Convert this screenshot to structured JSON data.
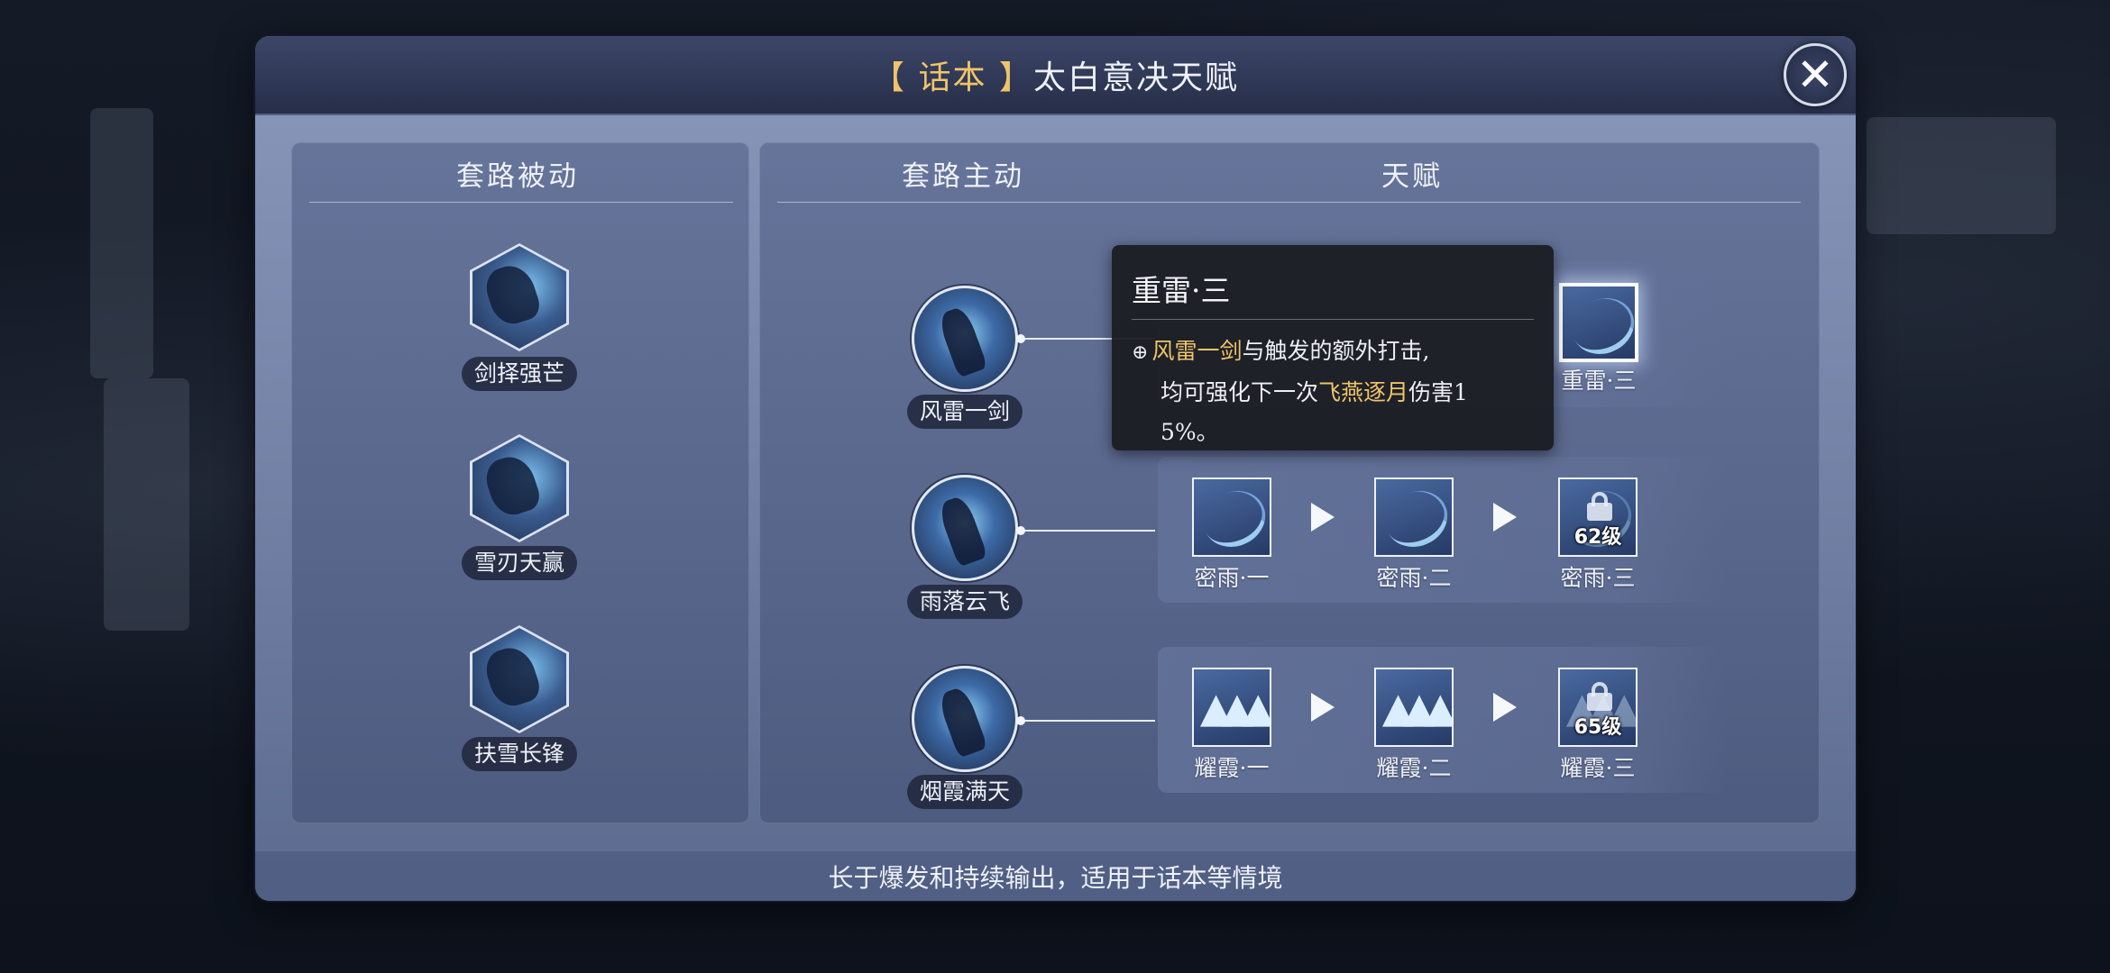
{
  "window": {
    "title_tag": "【 话本 】",
    "title": "太白意决天赋",
    "close_glyph": "✕"
  },
  "columns": {
    "passive": "套路被动",
    "active": "套路主动",
    "talent": "天赋"
  },
  "passive_skills": [
    {
      "name": "剑择强芒"
    },
    {
      "name": "雪刃天赢"
    },
    {
      "name": "扶雪长锋"
    }
  ],
  "active_skills": [
    {
      "name": "风雷一剑"
    },
    {
      "name": "雨落云飞"
    },
    {
      "name": "烟霞满天"
    }
  ],
  "talents": {
    "row1": [
      {
        "label": "重雷·三",
        "selected": true,
        "icon": "lightning-slash-icon"
      }
    ],
    "row2": [
      {
        "label": "密雨·一",
        "icon": "rain-slash-icon"
      },
      {
        "label": "密雨·二",
        "icon": "rain-slash-icon"
      },
      {
        "label": "密雨·三",
        "locked": true,
        "level_req": "62级",
        "icon": "lock-icon"
      }
    ],
    "row3": [
      {
        "label": "耀霞·一",
        "icon": "arrows-up-icon"
      },
      {
        "label": "耀霞·二",
        "icon": "arrows-up-icon"
      },
      {
        "label": "耀霞·三",
        "locked": true,
        "level_req": "65级",
        "icon": "lock-icon"
      }
    ]
  },
  "tooltip": {
    "title": "重雷·三",
    "bullet": "⊕",
    "skill_ref": "风雷一剑",
    "text_a": "与触发的额外打击,",
    "text_b": "均可强化下一次",
    "skill_ref2": "飞燕逐月",
    "text_c": "伤害1",
    "text_d": "5%。"
  },
  "footer": {
    "description": "长于爆发和持续输出，适用于话本等情境"
  },
  "colors": {
    "accent_gold": "#f0c469",
    "panel": "#7180a4",
    "titlebar": "#262e48"
  }
}
